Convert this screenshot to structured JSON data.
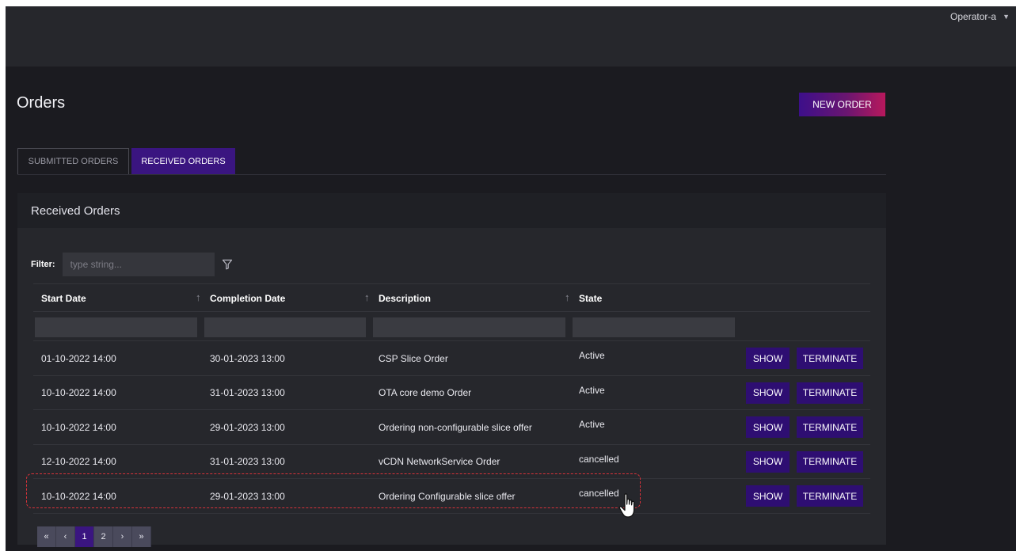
{
  "user": {
    "name": "Operator-a"
  },
  "page": {
    "title": "Orders",
    "new_order_label": "NEW ORDER"
  },
  "tabs": [
    {
      "label": "SUBMITTED ORDERS",
      "active": false
    },
    {
      "label": "RECEIVED ORDERS",
      "active": true
    }
  ],
  "panel": {
    "title": "Received Orders"
  },
  "filter": {
    "label": "Filter:",
    "placeholder": "type string..."
  },
  "columns": [
    "Start Date",
    "Completion Date",
    "Description",
    "State"
  ],
  "rows": [
    {
      "start": "01-10-2022 14:00",
      "completion": "30-01-2023 13:00",
      "description": "CSP Slice Order",
      "state": "Active"
    },
    {
      "start": "10-10-2022 14:00",
      "completion": "31-01-2023 13:00",
      "description": "OTA core demo Order",
      "state": "Active"
    },
    {
      "start": "10-10-2022 14:00",
      "completion": "29-01-2023 13:00",
      "description": "Ordering non-configurable slice offer",
      "state": "Active"
    },
    {
      "start": "12-10-2022 14:00",
      "completion": "31-01-2023 13:00",
      "description": "vCDN NetworkService Order",
      "state": "cancelled"
    },
    {
      "start": "10-10-2022 14:00",
      "completion": "29-01-2023 13:00",
      "description": "Ordering Configurable slice offer",
      "state": "cancelled"
    }
  ],
  "row_actions": {
    "show": "SHOW",
    "terminate": "TERMINATE"
  },
  "pagination": {
    "first": "«",
    "prev": "‹",
    "pages": [
      "1",
      "2"
    ],
    "current": "1",
    "next": "›",
    "last": "»"
  },
  "colors": {
    "accent": "#3a1580",
    "button": "#2e0e72",
    "highlight": "#d8323a",
    "background": "#1b1b20"
  }
}
